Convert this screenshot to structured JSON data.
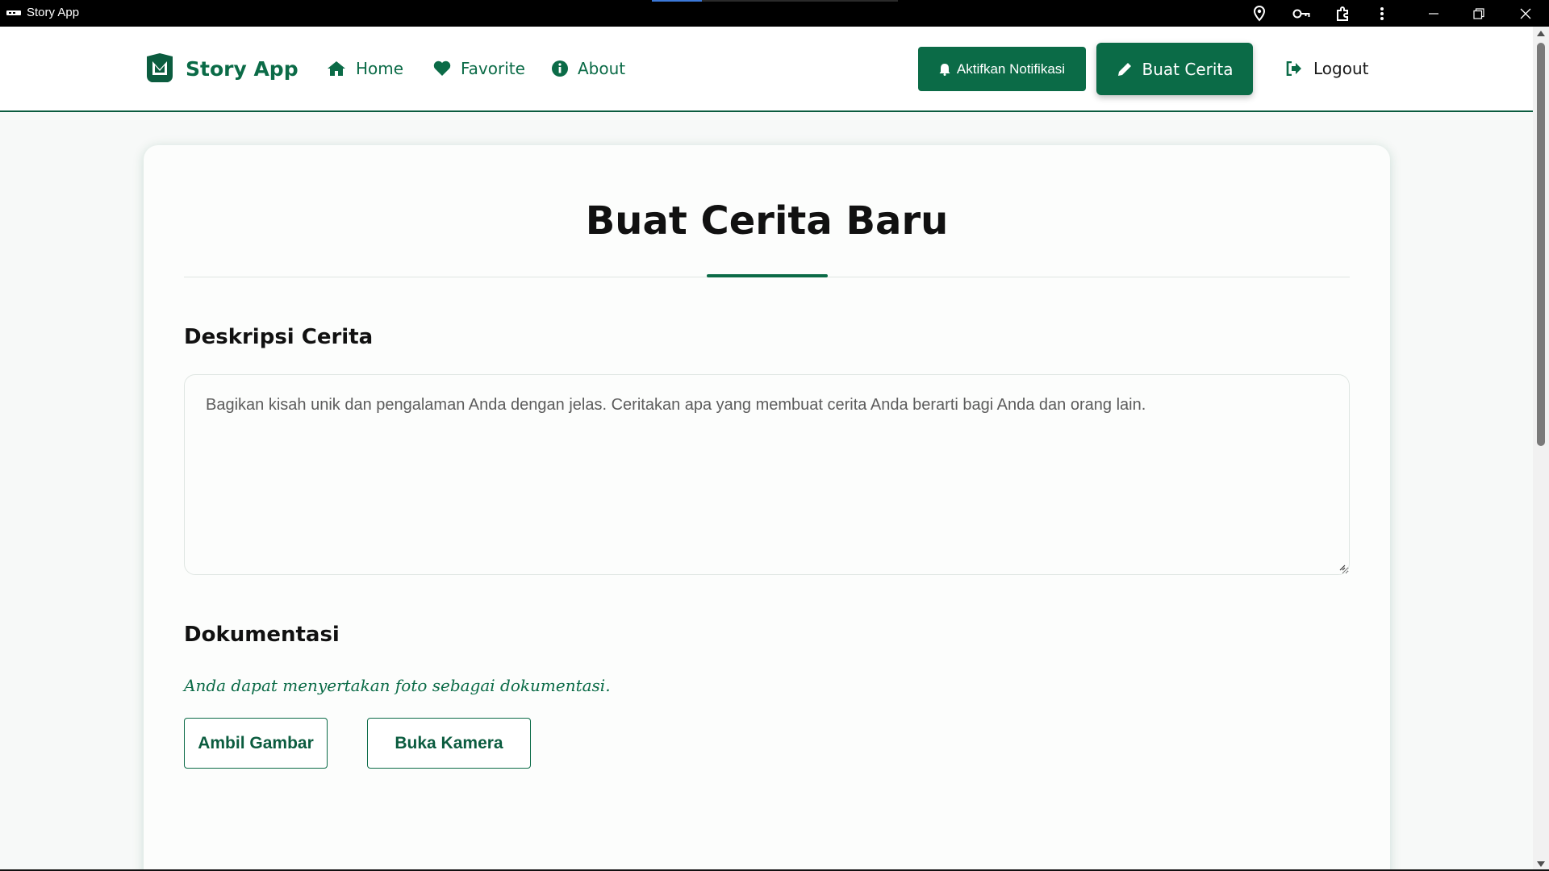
{
  "window": {
    "title": "Story App"
  },
  "navbar": {
    "brand": "Story App",
    "links": [
      {
        "label": "Home",
        "icon": "home-icon"
      },
      {
        "label": "Favorite",
        "icon": "heart-icon"
      },
      {
        "label": "About",
        "icon": "info-icon"
      }
    ],
    "notify_label": "Aktifkan Notifikasi",
    "create_label": "Buat Cerita",
    "logout_label": "Logout"
  },
  "form": {
    "title": "Buat Cerita Baru",
    "description_heading": "Deskripsi Cerita",
    "description_placeholder": "Bagikan kisah unik dan pengalaman Anda dengan jelas. Ceritakan apa yang membuat cerita Anda berarti bagi Anda dan orang lain.",
    "description_value": "",
    "documentation_heading": "Dokumentasi",
    "documentation_note": "Anda dapat menyertakan foto sebagai dokumentasi.",
    "take_picture_label": "Ambil Gambar",
    "open_camera_label": "Buka Kamera"
  },
  "colors": {
    "primary": "#0b6b47",
    "title_bar": "#000000",
    "page_background": "#f7f9f8"
  }
}
